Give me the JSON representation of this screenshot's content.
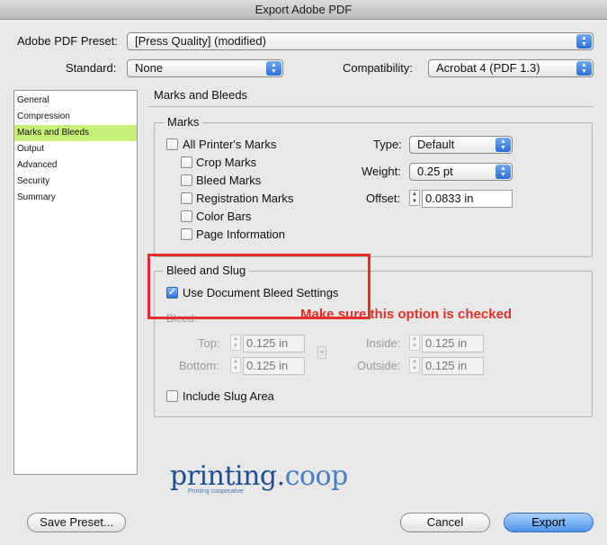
{
  "window": {
    "title": "Export Adobe PDF"
  },
  "header": {
    "preset_label": "Adobe PDF Preset:",
    "preset_value": "[Press Quality] (modified)",
    "standard_label": "Standard:",
    "standard_value": "None",
    "compatibility_label": "Compatibility:",
    "compatibility_value": "Acrobat 4 (PDF 1.3)"
  },
  "sidebar": {
    "items": [
      {
        "label": "General"
      },
      {
        "label": "Compression"
      },
      {
        "label": "Marks and Bleeds",
        "selected": true
      },
      {
        "label": "Output"
      },
      {
        "label": "Advanced"
      },
      {
        "label": "Security"
      },
      {
        "label": "Summary"
      }
    ]
  },
  "panel": {
    "title": "Marks and Bleeds",
    "marks": {
      "legend": "Marks",
      "all_printers_marks": "All Printer's Marks",
      "crop_marks": "Crop Marks",
      "bleed_marks": "Bleed Marks",
      "registration_marks": "Registration Marks",
      "color_bars": "Color Bars",
      "page_information": "Page Information",
      "type_label": "Type:",
      "type_value": "Default",
      "weight_label": "Weight:",
      "weight_value": "0.25 pt",
      "offset_label": "Offset:",
      "offset_value": "0.0833 in"
    },
    "bleed": {
      "legend": "Bleed and Slug",
      "use_document_bleed": "Use Document Bleed Settings",
      "use_document_bleed_checked": true,
      "bleed_label": "Bleed:",
      "top_label": "Top:",
      "top_value": "0.125 in",
      "bottom_label": "Bottom:",
      "bottom_value": "0.125 in",
      "inside_label": "Inside:",
      "inside_value": "0.125 in",
      "outside_label": "Outside:",
      "outside_value": "0.125 in",
      "include_slug": "Include Slug Area"
    }
  },
  "annotation": {
    "text": "Make sure this option is checked",
    "color": "#e3302b"
  },
  "logo": {
    "main": "printing.",
    "accent": "coop",
    "sub": "Printing cooperative"
  },
  "buttons": {
    "save_preset": "Save Preset...",
    "cancel": "Cancel",
    "export": "Export"
  },
  "colors": {
    "accent_blue": "#2a6fd6",
    "sidebar_selected": "#c8f078"
  }
}
